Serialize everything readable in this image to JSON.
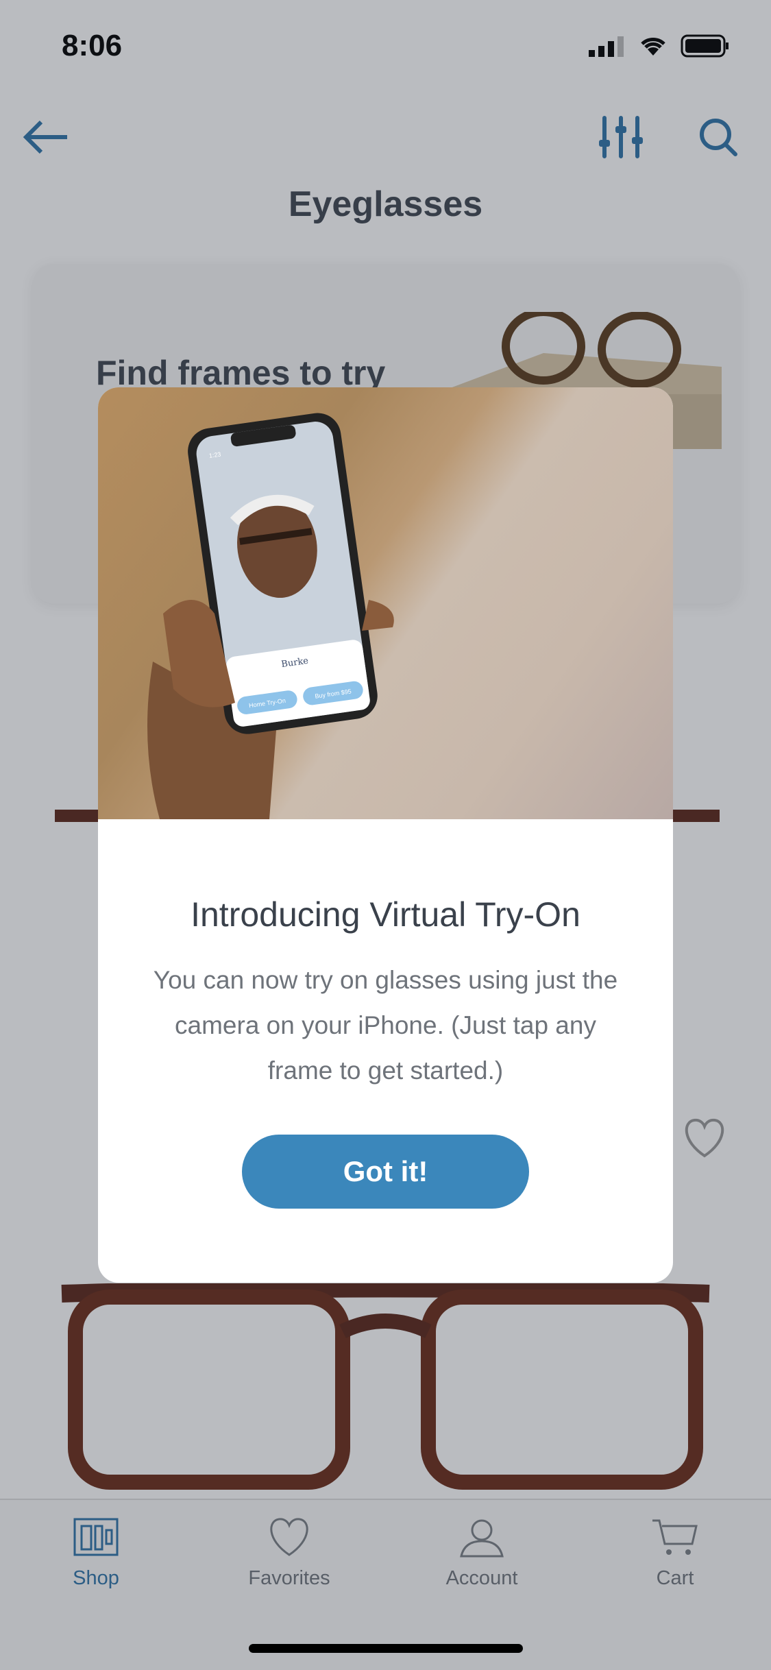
{
  "status_bar": {
    "time": "8:06"
  },
  "header": {
    "title": "Eyeglasses",
    "back_icon": "arrow-left-icon",
    "filter_icon": "sliders-icon",
    "search_icon": "search-icon"
  },
  "promo_card": {
    "title": "Find frames to try"
  },
  "modal": {
    "title": "Introducing Virtual Try-On",
    "body": "You can now try on glasses using just the camera on your iPhone. (Just tap any frame to get started.)",
    "button": "Got it!",
    "photo": {
      "frame_name": "Burke",
      "home_try_on": "Home Try-On",
      "buy": "Buy from $95",
      "phone_time": "1:23"
    }
  },
  "tabbar": {
    "items": [
      {
        "label": "Shop",
        "icon": "shop-icon",
        "active": true
      },
      {
        "label": "Favorites",
        "icon": "heart-icon"
      },
      {
        "label": "Account",
        "icon": "person-icon"
      },
      {
        "label": "Cart",
        "icon": "cart-icon"
      }
    ]
  },
  "colors": {
    "accent": "#3b87bb",
    "text": "#3f4650"
  }
}
